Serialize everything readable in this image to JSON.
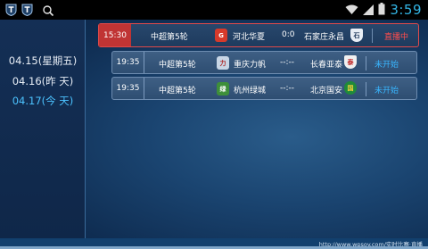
{
  "status_bar": {
    "time": "3:59",
    "icons": [
      "app-icon",
      "app-icon-2",
      "search-icon",
      "wifi-icon",
      "signal-icon",
      "battery-icon"
    ]
  },
  "dates": [
    {
      "label": "04.15(星期五)",
      "active": false
    },
    {
      "label": "04.16(昨  天)",
      "active": false
    },
    {
      "label": "04.17(今  天)",
      "active": true
    }
  ],
  "matches": [
    {
      "time": "15:30",
      "round": "中超第5轮",
      "home": "河北华夏",
      "score": "0:0",
      "away": "石家庄永昌",
      "status": "直播中",
      "live": true,
      "home_badge": "G",
      "away_badge": "石"
    },
    {
      "time": "19:35",
      "round": "中超第5轮",
      "home": "重庆力帆",
      "score": "--:--",
      "away": "长春亚泰",
      "status": "未开始",
      "live": false,
      "home_badge": "力",
      "away_badge": "泰"
    },
    {
      "time": "19:35",
      "round": "中超第5轮",
      "home": "杭州绿城",
      "score": "--:--",
      "away": "北京国安",
      "status": "未开始",
      "live": false,
      "home_badge": "绿",
      "away_badge": "国"
    }
  ],
  "watermark": "http://www.wpsoy.com/实时比赛·直播"
}
